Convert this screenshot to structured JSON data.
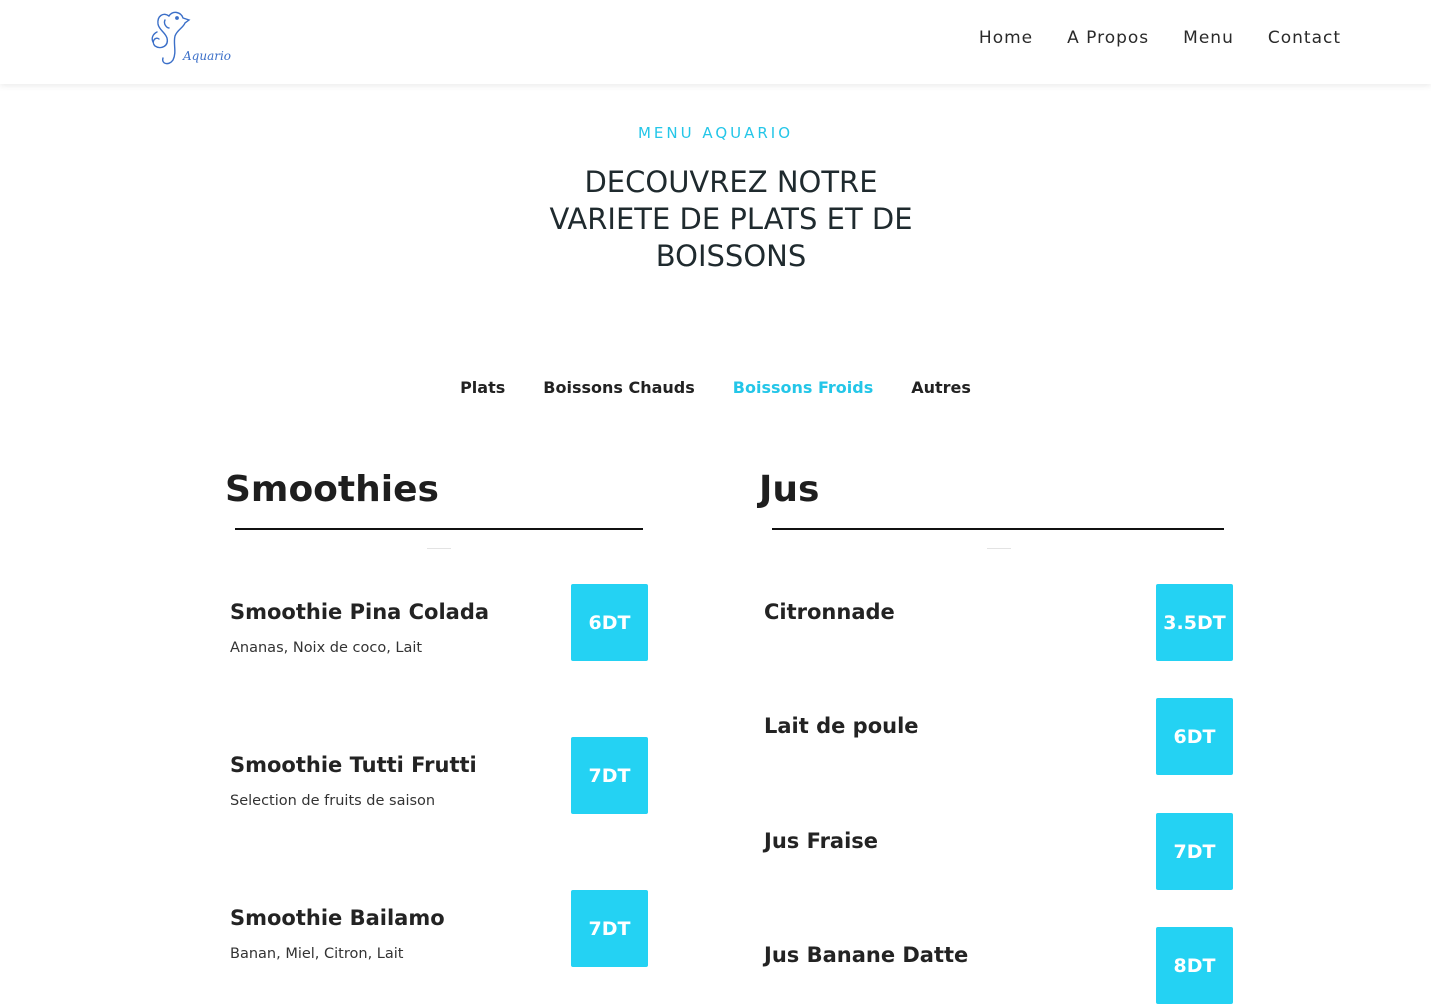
{
  "header": {
    "logo_icon": "seahorse-logo",
    "logo_text": "Aquario",
    "nav": [
      "Home",
      "A Propos",
      "Menu",
      "Contact"
    ]
  },
  "intro": {
    "kicker": "MENU AQUARIO",
    "headline_lines": [
      "DECOUVREZ NOTRE",
      "VARIETE DE PLATS ET DE",
      "BOISSONS"
    ]
  },
  "tabs": [
    {
      "label": "Plats",
      "active": false
    },
    {
      "label": "Boissons Chauds",
      "active": false
    },
    {
      "label": "Boissons Froids",
      "active": true
    },
    {
      "label": "Autres",
      "active": false
    }
  ],
  "colors": {
    "accent": "#24c6e8",
    "price_bg": "#24d2f3"
  },
  "smoothies": {
    "title": "Smoothies",
    "items": [
      {
        "name": "Smoothie Pina Colada",
        "desc": "Ananas, Noix de coco, Lait",
        "price": "6DT"
      },
      {
        "name": "Smoothie Tutti Frutti",
        "desc": "Selection de fruits de saison",
        "price": "7DT"
      },
      {
        "name": "Smoothie Bailamo",
        "desc": "Banan, Miel, Citron, Lait",
        "price": "7DT"
      }
    ]
  },
  "jus": {
    "title": "Jus",
    "items": [
      {
        "name": "Citronnade",
        "price": "3.5DT"
      },
      {
        "name": "Lait de poule",
        "price": "6DT"
      },
      {
        "name": "Jus Fraise",
        "price": "7DT"
      },
      {
        "name": "Jus Banane Datte",
        "price": "8DT"
      }
    ]
  }
}
